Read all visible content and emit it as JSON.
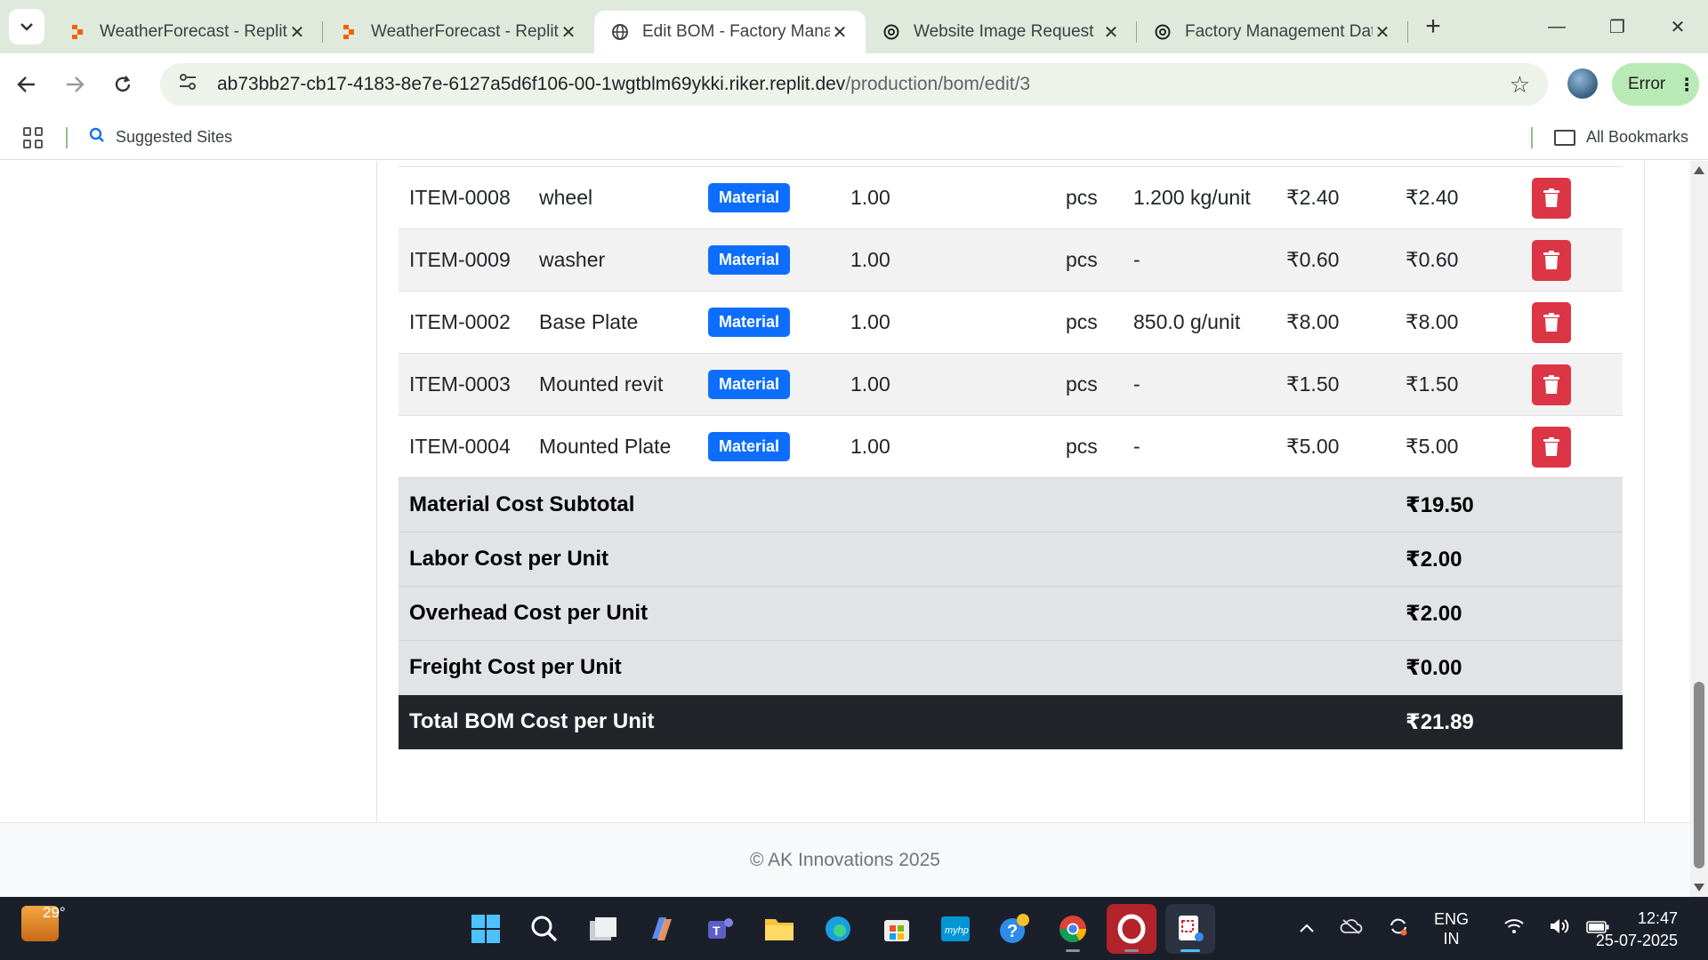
{
  "browser": {
    "tabs": [
      {
        "title": "WeatherForecast - Replit",
        "icon": "replit-icon",
        "active": false
      },
      {
        "title": "WeatherForecast - Replit",
        "icon": "replit-icon",
        "active": false
      },
      {
        "title": "Edit BOM - Factory Mana",
        "icon": "globe-icon",
        "active": true
      },
      {
        "title": "Website Image Request",
        "icon": "openai-icon",
        "active": false
      },
      {
        "title": "Factory Management Dat",
        "icon": "openai-icon",
        "active": false
      }
    ],
    "url_host": "ab73bb27-cb17-4183-8e7e-6127a5d6f106-00-1wgtblm69ykki.riker.replit.dev",
    "url_path": "/production/bom/edit/3",
    "profile_status": "Error",
    "bookmarks": {
      "suggested": "Suggested Sites",
      "all": "All Bookmarks"
    }
  },
  "bom": {
    "items": [
      {
        "code": "ITEM-0008",
        "name": "wheel",
        "type": "Material",
        "qty": "1.00",
        "unit": "pcs",
        "weight": "1.200 kg/unit",
        "unit_cost": "₹2.40",
        "total": "₹2.40"
      },
      {
        "code": "ITEM-0009",
        "name": "washer",
        "type": "Material",
        "qty": "1.00",
        "unit": "pcs",
        "weight": "-",
        "unit_cost": "₹0.60",
        "total": "₹0.60"
      },
      {
        "code": "ITEM-0002",
        "name": "Base Plate",
        "type": "Material",
        "qty": "1.00",
        "unit": "pcs",
        "weight": "850.0 g/unit",
        "unit_cost": "₹8.00",
        "total": "₹8.00"
      },
      {
        "code": "ITEM-0003",
        "name": "Mounted revit",
        "type": "Material",
        "qty": "1.00",
        "unit": "pcs",
        "weight": "-",
        "unit_cost": "₹1.50",
        "total": "₹1.50"
      },
      {
        "code": "ITEM-0004",
        "name": "Mounted Plate",
        "type": "Material",
        "qty": "1.00",
        "unit": "pcs",
        "weight": "-",
        "unit_cost": "₹5.00",
        "total": "₹5.00"
      }
    ],
    "summary": [
      {
        "label": "Material Cost Subtotal",
        "value": "₹19.50"
      },
      {
        "label": "Labor Cost per Unit",
        "value": "₹2.00"
      },
      {
        "label": "Overhead Cost per Unit",
        "value": "₹2.00"
      },
      {
        "label": "Freight Cost per Unit",
        "value": "₹0.00"
      }
    ],
    "total": {
      "label": "Total BOM Cost per Unit",
      "value": "₹21.89"
    }
  },
  "footer": {
    "text": "© AK Innovations 2025"
  },
  "taskbar": {
    "temperature": "29°",
    "lang_line1": "ENG",
    "lang_line2": "IN",
    "time": "12:47",
    "date": "25-07-2025"
  },
  "colors": {
    "badge": "#0d6efd",
    "delete": "#dc3545",
    "total_row": "#212529",
    "summary_row": "#e2e3e5"
  }
}
